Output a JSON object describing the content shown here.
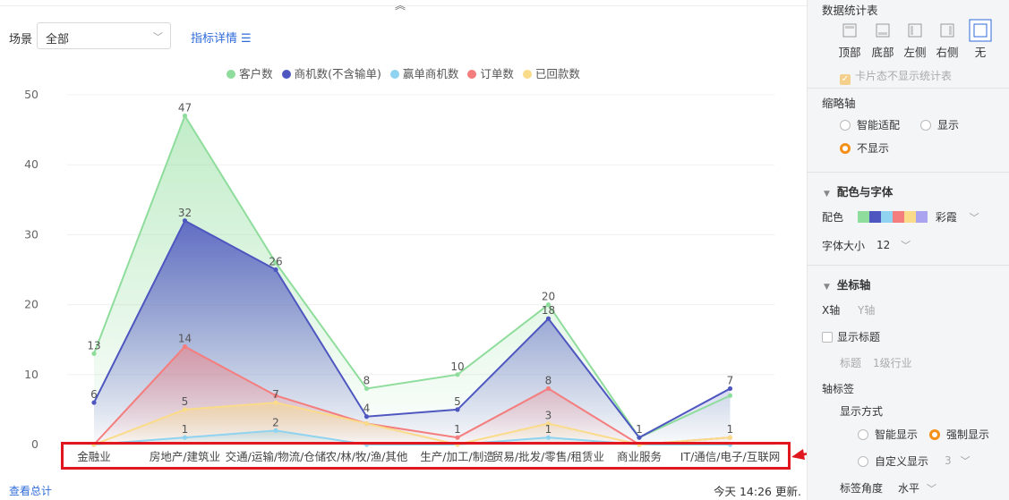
{
  "filter": {
    "scene_label": "场景",
    "scene_value": "全部",
    "detail_link": "指标详情"
  },
  "legend": [
    {
      "name": "客户数",
      "color": "#8fdd9c"
    },
    {
      "name": "商机数(不含输单)",
      "color": "#4e56c0"
    },
    {
      "name": "赢单商机数",
      "color": "#8fd3f0"
    },
    {
      "name": "订单数",
      "color": "#f47d7d"
    },
    {
      "name": "已回款数",
      "color": "#fadb8a"
    }
  ],
  "chart_data": {
    "type": "area",
    "categories": [
      "金融业",
      "房地产/建筑业",
      "交通/运输/物流/仓储",
      "农/林/牧/渔/其他",
      "生产/加工/制造",
      "贸易/批发/零售/租赁业",
      "商业服务",
      "IT/通信/电子/互联网"
    ],
    "ylim": [
      0,
      50
    ],
    "yticks": [
      0,
      10,
      20,
      30,
      40,
      50
    ],
    "grid": true,
    "legend_position": "top",
    "series": [
      {
        "name": "客户数",
        "color": "#8fdd9c",
        "values": [
          13,
          47,
          26,
          8,
          10,
          20,
          1,
          7
        ]
      },
      {
        "name": "商机数(不含输单)",
        "color": "#4e56c0",
        "values": [
          6,
          32,
          25,
          4,
          5,
          18,
          1,
          8
        ]
      },
      {
        "name": "赢单商机数",
        "color": "#8fd3f0",
        "values": [
          0,
          1,
          2,
          0,
          0,
          1,
          0,
          0
        ]
      },
      {
        "name": "订单数",
        "color": "#f47d7d",
        "values": [
          0,
          14,
          7,
          3,
          1,
          8,
          0,
          1
        ]
      },
      {
        "name": "已回款数",
        "color": "#fadb8a",
        "values": [
          0,
          5,
          6,
          3,
          0,
          3,
          0,
          1
        ]
      }
    ],
    "labels": [
      {
        "idx": 0,
        "series": 0,
        "text": "13"
      },
      {
        "idx": 0,
        "series": 1,
        "text": "6"
      },
      {
        "idx": 1,
        "series": 0,
        "text": "47"
      },
      {
        "idx": 1,
        "series": 1,
        "text": "32"
      },
      {
        "idx": 1,
        "series": 3,
        "text": "14"
      },
      {
        "idx": 1,
        "series": 4,
        "text": "5"
      },
      {
        "idx": 1,
        "series": 2,
        "text": "1"
      },
      {
        "idx": 2,
        "series": 1,
        "text": "26"
      },
      {
        "idx": 2,
        "series": 4,
        "text": "7"
      },
      {
        "idx": 2,
        "series": 2,
        "text": "2"
      },
      {
        "idx": 3,
        "series": 0,
        "text": "8"
      },
      {
        "idx": 3,
        "series": 1,
        "text": "4"
      },
      {
        "idx": 4,
        "series": 0,
        "text": "10"
      },
      {
        "idx": 4,
        "series": 1,
        "text": "5"
      },
      {
        "idx": 4,
        "series": 3,
        "text": "1"
      },
      {
        "idx": 5,
        "series": 0,
        "text": "20"
      },
      {
        "idx": 5,
        "series": 1,
        "text": "18"
      },
      {
        "idx": 5,
        "series": 3,
        "text": "8"
      },
      {
        "idx": 5,
        "series": 4,
        "text": "3"
      },
      {
        "idx": 5,
        "series": 2,
        "text": "1"
      },
      {
        "idx": 6,
        "series": 1,
        "text": "1"
      },
      {
        "idx": 7,
        "series": 1,
        "text": "7"
      },
      {
        "idx": 7,
        "series": 4,
        "text": "1"
      }
    ]
  },
  "footer": {
    "view_total": "查看总计",
    "updated": "今天 14:26 更新."
  },
  "panel": {
    "stats_table_title": "数据统计表",
    "positions": [
      "顶部",
      "底部",
      "左侧",
      "右侧",
      "无"
    ],
    "selected_position": "无",
    "card_hide_label": "卡片态不显示统计表",
    "thumb_axis_title": "缩略轴",
    "thumb_options": [
      "智能适配",
      "显示",
      "不显示"
    ],
    "thumb_selected": "不显示",
    "color_font_title": "配色与字体",
    "color_label": "配色",
    "color_scheme_name": "彩霞",
    "palette": [
      "#8fdd9c",
      "#4e56c0",
      "#8fd3f0",
      "#f47d7d",
      "#fadb8a",
      "#a9a3f0"
    ],
    "font_size_label": "字体大小",
    "font_size_value": "12",
    "axis_title": "坐标轴",
    "axis_tabs": [
      "X轴",
      "Y轴"
    ],
    "show_title_label": "显示标题",
    "title_label": "标题",
    "title_value": "1级行业",
    "axis_label_title": "轴标签",
    "display_mode_label": "显示方式",
    "display_options": [
      "智能显示",
      "强制显示",
      "自定义显示"
    ],
    "display_selected": "强制显示",
    "custom_count": "3",
    "label_angle_label": "标签角度",
    "label_angle_value": "水平"
  }
}
